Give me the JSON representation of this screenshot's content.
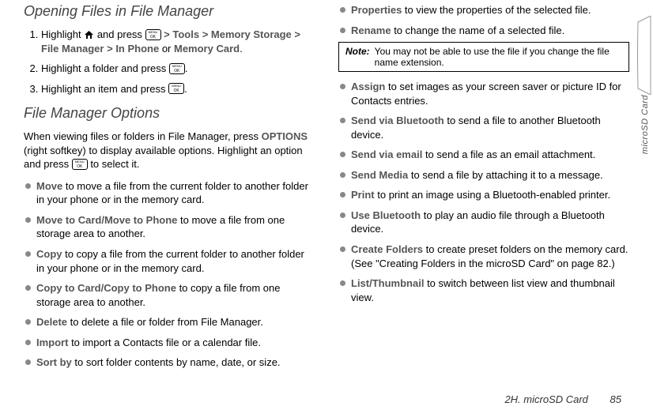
{
  "side_tab_label": "microSD Card",
  "section1": {
    "title": "Opening Files in File Manager",
    "steps": [
      {
        "pre": "Highlight ",
        "post_home": " and press ",
        "trail": " ",
        "path": [
          "Tools",
          "Memory Storage",
          "File Manager",
          "In Phone"
        ],
        "or_text": " or ",
        "or_item": "Memory Card",
        "end": "."
      },
      {
        "text_pre": "Highlight a folder and press ",
        "text_post": "."
      },
      {
        "text_pre": "Highlight an item and press ",
        "text_post": "."
      }
    ]
  },
  "section2": {
    "title": "File Manager Options",
    "intro_a": "When viewing files or folders in File Manager, press ",
    "intro_b": "OPTIONS",
    "intro_c": " (right softkey) to display available options. Highlight an option and press ",
    "intro_d": " to select it.",
    "bullets": [
      {
        "term": "Move",
        "rest": " to move a file from the current folder to another folder in your phone or in the memory card."
      },
      {
        "term": "Move to Card/Move to Phone",
        "rest": " to move a file from one storage area to another."
      },
      {
        "term": "Copy",
        "rest": " to copy a file from the current folder to another folder in your phone or in the memory card."
      },
      {
        "term": "Copy to Card/Copy to Phone",
        "rest": " to copy a file from one storage area to another."
      },
      {
        "term": "Delete",
        "rest": " to delete a file or folder from File Manager."
      },
      {
        "term": "Import",
        "rest": " to import a Contacts file or a calendar file."
      },
      {
        "term": "Sort by",
        "rest": " to sort folder contents by name, date, or size."
      },
      {
        "term": "Properties",
        "rest": " to view the properties of the selected file."
      },
      {
        "term": "Rename",
        "rest": " to change the name of a selected file."
      }
    ],
    "note_label": "Note:",
    "note_text": "You may not be able to use the file if you change the file name extension.",
    "bullets2": [
      {
        "term": "Assign",
        "rest": " to set images as your screen saver or picture ID for Contacts entries."
      },
      {
        "term": "Send via Bluetooth",
        "rest": " to send a file to another Bluetooth device."
      },
      {
        "term": "Send via email",
        "rest": " to send a file as an email attachment."
      },
      {
        "term": "Send Media",
        "rest": " to send a file by attaching it to a message."
      },
      {
        "term": "Print",
        "rest": " to print an image using a Bluetooth-enabled printer."
      },
      {
        "term": "Use Bluetooth",
        "rest": " to play an audio file through a Bluetooth device."
      },
      {
        "term": "Create Folders",
        "rest": " to create preset folders on the memory card. (See \"Creating Folders in the microSD Card\" on page 82.)"
      },
      {
        "term": "List/Thumbnail",
        "rest": " to switch between list view and thumbnail view."
      }
    ]
  },
  "footer": {
    "section": "2H. microSD Card",
    "page": "85"
  }
}
